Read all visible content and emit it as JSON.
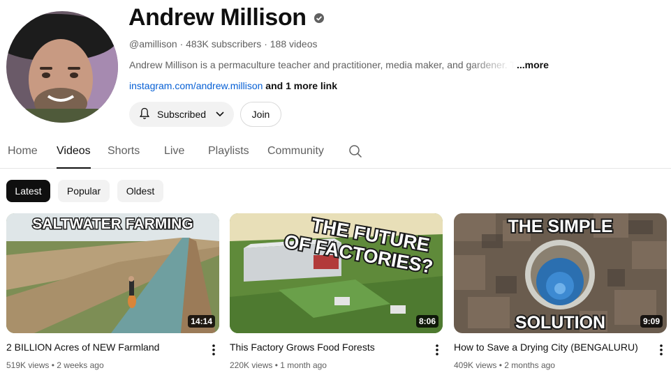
{
  "channel": {
    "name": "Andrew Millison",
    "handle": "@amillison",
    "subscribers": "483K subscribers",
    "videos": "188 videos",
    "description": "Andrew Millison is a permaculture teacher and practitioner, media maker, and gardener. Th",
    "more_label": "...more",
    "link": "instagram.com/andrew.millison",
    "more_links": "and 1 more link",
    "subscribed_label": "Subscribed",
    "join_label": "Join"
  },
  "tabs": [
    "Home",
    "Videos",
    "Shorts",
    "Live",
    "Playlists",
    "Community"
  ],
  "active_tab": "Videos",
  "chips": [
    "Latest",
    "Popular",
    "Oldest"
  ],
  "active_chip": "Latest",
  "videos": [
    {
      "title": "2 BILLION Acres of NEW Farmland",
      "views": "519K views",
      "age": "2 weeks ago",
      "duration": "14:14",
      "thumb_text": "SALTWATER FARMING"
    },
    {
      "title": "This Factory Grows Food Forests",
      "views": "220K views",
      "age": "1 month ago",
      "duration": "8:06",
      "thumb_text_1": "THE FUTURE",
      "thumb_text_2": "OF FACTORIES?"
    },
    {
      "title": "How to Save a Drying City (BENGALURU)",
      "views": "409K views",
      "age": "2 months ago",
      "duration": "9:09",
      "thumb_text_1": "THE SIMPLE",
      "thumb_text_2": "SOLUTION"
    }
  ],
  "colors": {
    "link": "#065fd4",
    "secondary_text": "#606060",
    "chip_bg": "#f2f2f2",
    "chip_active_bg": "#0f0f0f"
  }
}
